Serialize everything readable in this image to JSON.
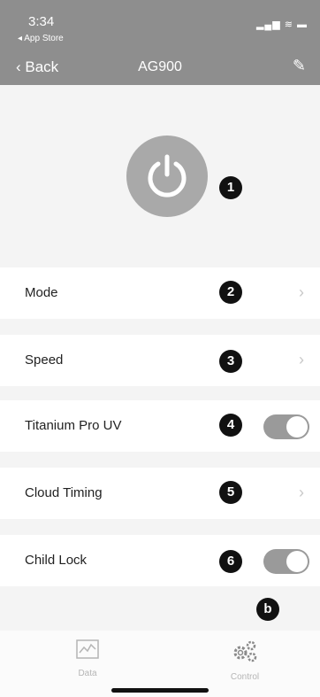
{
  "status": {
    "time": "3:34",
    "back_app": "◂ App Store",
    "icons": "▂▄▆ ≋ ▬"
  },
  "nav": {
    "back": "‹ Back",
    "title": "AG900",
    "edit_icon": "✎"
  },
  "callouts": {
    "power": "1",
    "mode": "2",
    "speed": "3",
    "titanium": "4",
    "cloud": "5",
    "child": "6",
    "tabbar": "b"
  },
  "rows": {
    "mode": {
      "label": "Mode"
    },
    "speed": {
      "label": "Speed"
    },
    "titanium": {
      "label": "Titanium Pro UV",
      "toggle_on": true
    },
    "cloud": {
      "label": "Cloud Timing"
    },
    "child": {
      "label": "Child Lock",
      "toggle_on": true
    }
  },
  "chevron": "›",
  "tabs": {
    "data": {
      "label": "Data",
      "icon": "chart-icon"
    },
    "control": {
      "label": "Control",
      "icon": "gears-icon"
    }
  }
}
